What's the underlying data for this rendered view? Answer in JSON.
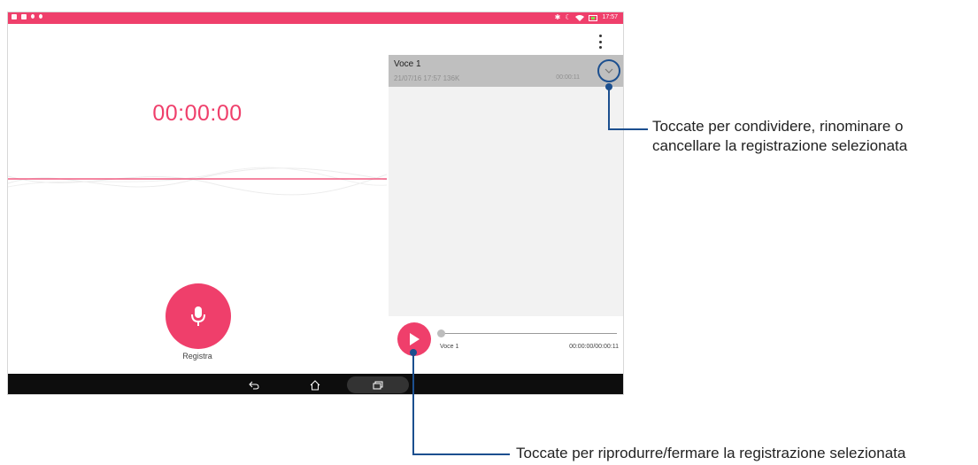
{
  "status_bar": {
    "time": "17:57"
  },
  "recorder": {
    "timer": "00:00:00",
    "record_label": "Registra"
  },
  "recordings": [
    {
      "title": "Voce 1",
      "meta": "21/07/16 17:57  136K",
      "duration": "00:00:11"
    }
  ],
  "player": {
    "name": "Voce 1",
    "time": "00:00:00/00:00:11",
    "progress": 0
  },
  "callouts": {
    "top_line1": "Toccate per condividere, rinominare o",
    "top_line2": "cancellare la registrazione selezionata",
    "bottom": "Toccate per riprodurre/fermare la registrazione selezionata"
  },
  "colors": {
    "accent": "#ef3f6b",
    "callout": "#1c4f8f",
    "selected_row": "#bfbfbf"
  }
}
